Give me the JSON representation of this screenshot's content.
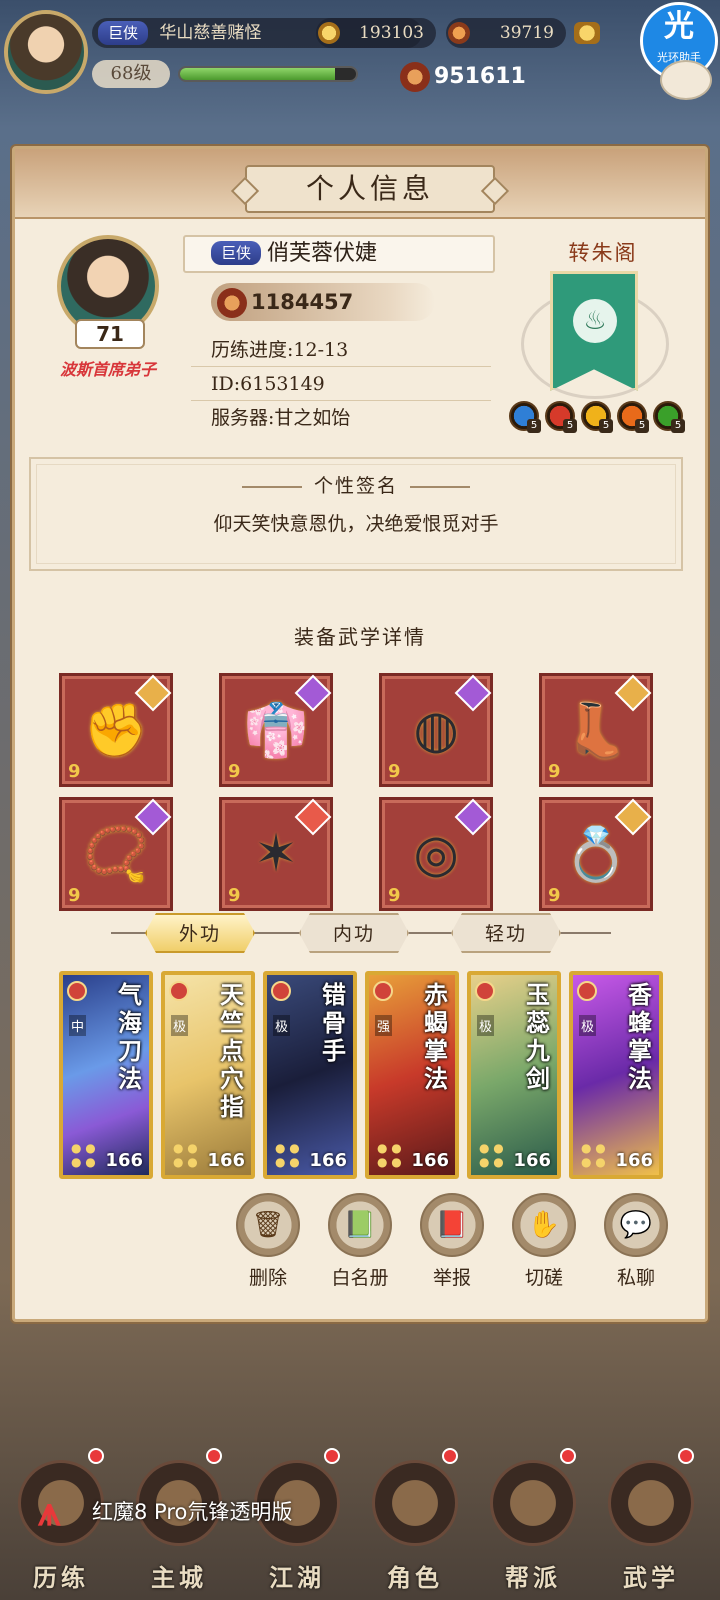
{
  "top": {
    "rank": "巨侠",
    "player_name": "华山慈善赌怪",
    "copper": "193103",
    "currency2": "39719",
    "level": "68级",
    "exp_fraction": 0.88,
    "power": "951611"
  },
  "assistant": {
    "icon_text": "光",
    "label": "光环助手"
  },
  "panel": {
    "title": "个人信息",
    "level": "71",
    "title_badge": "波斯首席弟子",
    "rank": "巨侠",
    "name": "俏芙蓉伏婕",
    "power": "1184457",
    "progress": "历练进度:12-13",
    "id": "ID:6153149",
    "server": "服务器:甘之如饴",
    "sect_name": "转朱阁",
    "elements": [
      {
        "name": "water-element-icon",
        "color": "#2f7fd6",
        "level": "5"
      },
      {
        "name": "fire-element-icon",
        "color": "#d63a2a",
        "level": "5"
      },
      {
        "name": "sun-element-icon",
        "color": "#f0b21a",
        "level": "5"
      },
      {
        "name": "blaze-element-icon",
        "color": "#e86a1a",
        "level": "5"
      },
      {
        "name": "wood-element-icon",
        "color": "#3aa02a",
        "level": "5"
      }
    ]
  },
  "signature": {
    "title": "个性签名",
    "text": "仰天笑快意恩仇，决绝爱恨觅对手"
  },
  "equipment": {
    "title": "装备武学详情",
    "items": [
      {
        "name": "gauntlet",
        "glyph": "✊",
        "quality_color": "#e8b04a",
        "num": "9"
      },
      {
        "name": "robe",
        "glyph": "👘",
        "quality_color": "#a35ad6",
        "num": "9"
      },
      {
        "name": "belt",
        "glyph": "◍",
        "quality_color": "#a35ad6",
        "num": "9"
      },
      {
        "name": "boots",
        "glyph": "👢",
        "quality_color": "#e8b04a",
        "num": "9"
      },
      {
        "name": "necklace",
        "glyph": "📿",
        "quality_color": "#a35ad6",
        "num": "9"
      },
      {
        "name": "hairpin",
        "glyph": "✶",
        "quality_color": "#e85a4a",
        "num": "9"
      },
      {
        "name": "bracelet",
        "glyph": "◎",
        "quality_color": "#a35ad6",
        "num": "9"
      },
      {
        "name": "ring",
        "glyph": "💍",
        "quality_color": "#e8b04a",
        "num": "9"
      }
    ]
  },
  "tabs": [
    "外功",
    "内功",
    "轻功"
  ],
  "skills": [
    {
      "name": "气海刀法",
      "grade": "中",
      "level": "166",
      "bg": "linear-gradient(160deg,#2a3f8a,#6a9ae8 45%,#8a5ad6 70%,#1e2a5a)"
    },
    {
      "name": "天竺点穴指",
      "grade": "极",
      "level": "166",
      "bg": "linear-gradient(160deg,#f5e3a8,#e8c46a 50%,#9a7a3a)"
    },
    {
      "name": "错骨手",
      "grade": "极",
      "level": "166",
      "bg": "linear-gradient(160deg,#3a4a7a,#1a1e3a 50%,#4a5aa8)"
    },
    {
      "name": "赤蝎掌法",
      "grade": "强",
      "level": "166",
      "bg": "linear-gradient(160deg,#e8a03a,#c83a2a 50%,#5a1a1a)"
    },
    {
      "name": "玉蕊九剑",
      "grade": "极",
      "level": "166",
      "bg": "linear-gradient(160deg,#e8d08a,#7aa86a 50%,#2a5a4a)"
    },
    {
      "name": "香蜂掌法",
      "grade": "极",
      "level": "166",
      "bg": "linear-gradient(160deg,#c85ae8,#6a2aa8 50%,#f0c04a)"
    }
  ],
  "actions": [
    {
      "name": "delete",
      "icon": "🗑",
      "label": "删除"
    },
    {
      "name": "whitelist",
      "icon": "📗",
      "label": "白名册"
    },
    {
      "name": "report",
      "icon": "📕",
      "label": "举报"
    },
    {
      "name": "spar",
      "icon": "✋",
      "label": "切磋"
    },
    {
      "name": "private-chat",
      "icon": "💬",
      "label": "私聊"
    }
  ],
  "nav": [
    "历练",
    "主城",
    "江湖",
    "角色",
    "帮派",
    "武学"
  ],
  "device_label": "红魔8 Pro氘锋透明版"
}
